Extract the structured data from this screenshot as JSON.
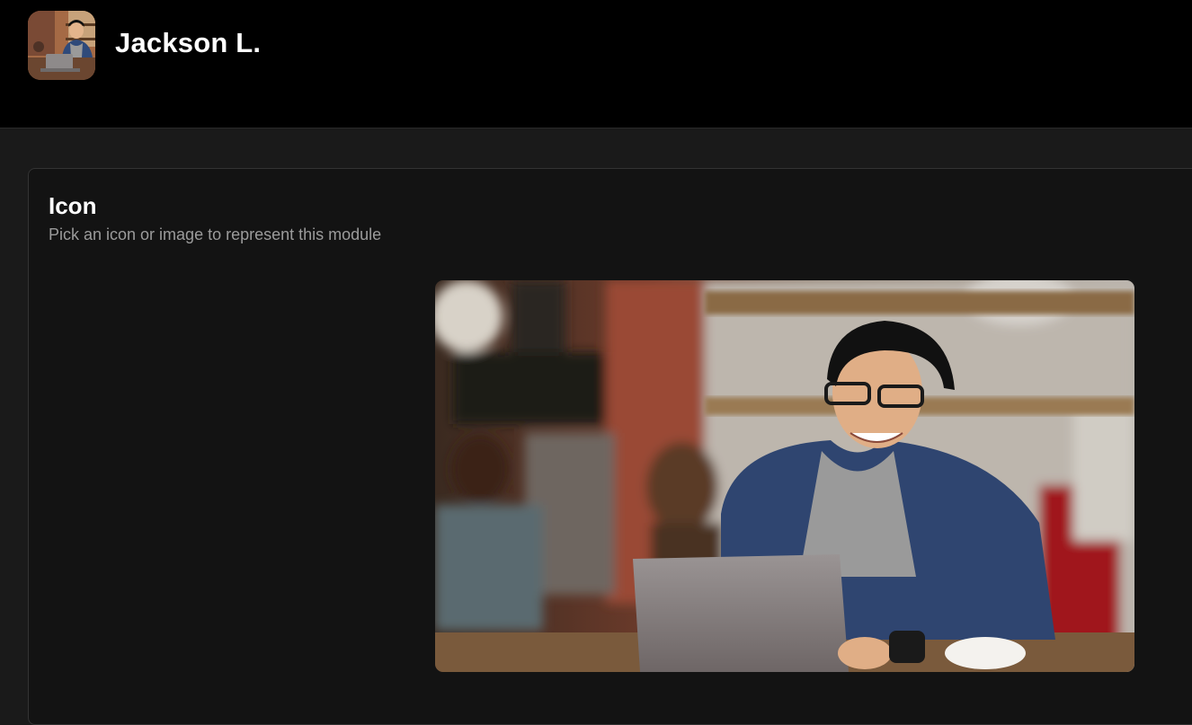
{
  "header": {
    "user_name": "Jackson L.",
    "avatar_icon": "user-photo-icon"
  },
  "icon_section": {
    "title": "Icon",
    "subtitle": "Pick an icon or image to represent this module",
    "selected_image_icon": "photo-person-laptop-cafe-icon"
  },
  "colors": {
    "header_bg": "#000000",
    "page_bg": "#1a1a1a",
    "card_bg": "#131313",
    "card_border": "#333333",
    "subtitle_text": "#9b9b9b"
  }
}
